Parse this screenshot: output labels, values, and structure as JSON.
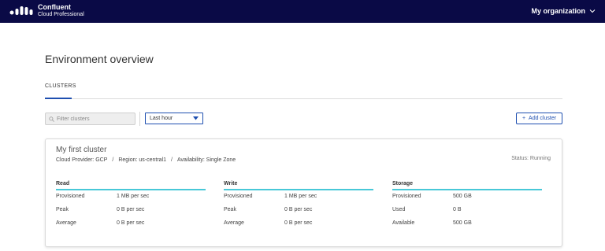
{
  "header": {
    "brand_name": "Confluent",
    "brand_sub": "Cloud Professional",
    "org_label": "My organization",
    "colors": {
      "bar": "#0a0a46",
      "accent": "#1e4fb0",
      "teal": "#48c8d8"
    }
  },
  "page": {
    "title": "Environment overview",
    "tabs": [
      {
        "label": "CLUSTERS",
        "active": true
      }
    ]
  },
  "toolbar": {
    "filter_placeholder": "Filter clusters",
    "time_range": "Last hour",
    "add_cluster_label": "Add cluster"
  },
  "cluster": {
    "name": "My first cluster",
    "provider": "Cloud Provider: GCP",
    "region": "Region: us-central1",
    "availability": "Availability: Single Zone",
    "separator": "/",
    "status": "Status: Running",
    "sections": [
      {
        "title": "Read",
        "rows": [
          {
            "label": "Provisioned",
            "value": "1 MB per sec"
          },
          {
            "label": "Peak",
            "value": "0 B per sec"
          },
          {
            "label": "Average",
            "value": "0 B per sec"
          }
        ]
      },
      {
        "title": "Write",
        "rows": [
          {
            "label": "Provisioned",
            "value": "1 MB per sec"
          },
          {
            "label": "Peak",
            "value": "0 B per sec"
          },
          {
            "label": "Average",
            "value": "0 B per sec"
          }
        ]
      },
      {
        "title": "Storage",
        "rows": [
          {
            "label": "Provisioned",
            "value": "500 GB"
          },
          {
            "label": "Used",
            "value": "0 B"
          },
          {
            "label": "Available",
            "value": "500 GB"
          }
        ]
      }
    ]
  }
}
